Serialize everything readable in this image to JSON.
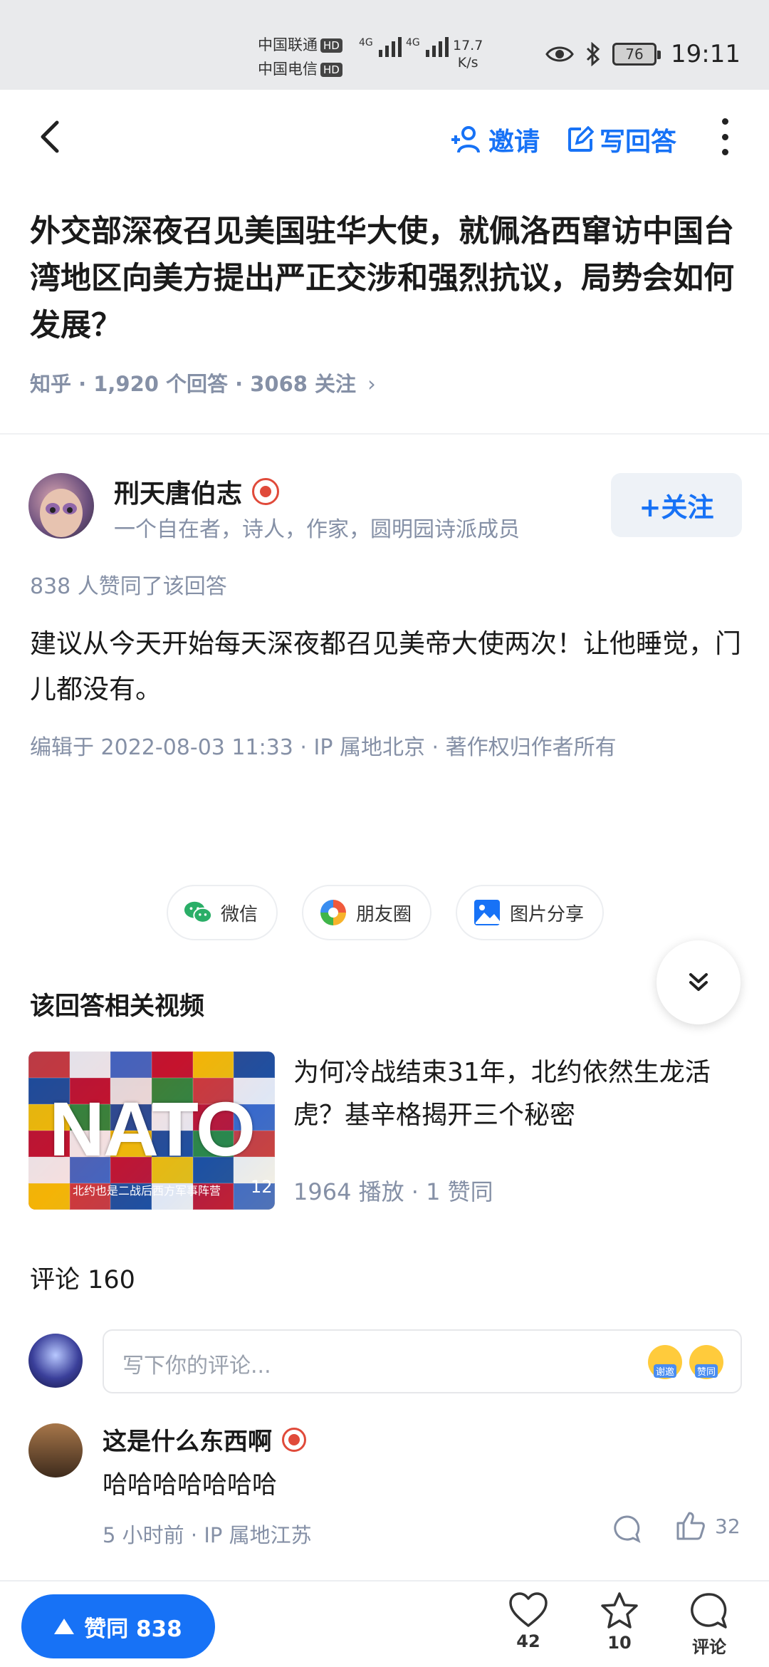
{
  "status_bar": {
    "carrier1": "中国联通",
    "carrier2": "中国电信",
    "hd": "HD",
    "net1": "4G",
    "net2": "4G",
    "speed_value": "17.7",
    "speed_unit": "K/s",
    "battery": "76",
    "time": "19:11"
  },
  "nav": {
    "invite_label": "邀请",
    "write_answer_label": "写回答"
  },
  "question": {
    "title": "外交部深夜召见美国驻华大使，就佩洛西窜访中国台湾地区向美方提出严正交涉和强烈抗议，局势会如何发展？",
    "meta": "知乎 · 1,920 个回答 · 3068 关注"
  },
  "answer": {
    "author_name": "刑天唐伯志",
    "author_bio": "一个自在者，诗人，作家，圆明园诗派成员",
    "follow_label": "+关注",
    "upvote_info": "838 人赞同了该回答",
    "body": "建议从今天开始每天深夜都召见美帝大使两次！让他睡觉，门儿都没有。",
    "meta": "编辑于 2022-08-03 11:33 · IP 属地北京 · 著作权归作者所有"
  },
  "share": {
    "wechat": "微信",
    "moments": "朋友圈",
    "image_share": "图片分享"
  },
  "related": {
    "title": "该回答相关视频",
    "video": {
      "thumb_word": "NATO",
      "thumb_caption": "北约也是二战后西方军事阵营",
      "duration": "12",
      "title": "为何冷战结束31年，北约依然生龙活虎？基辛格揭开三个秘密",
      "meta": "1964 播放 · 1 赞同"
    }
  },
  "comments": {
    "title": "评论 160",
    "placeholder": "写下你的评论...",
    "emoji1": "谢邀",
    "emoji2": "赞同",
    "items": [
      {
        "name": "这是什么东西啊",
        "text": "哈哈哈哈哈哈哈",
        "meta": "5 小时前 · IP 属地江苏",
        "likes": "32"
      }
    ]
  },
  "bottom_bar": {
    "vote_label": "赞同 838",
    "likes": "42",
    "favorites": "10",
    "comment_label": "评论"
  },
  "colors": {
    "accent": "#1772f6",
    "meta_gray": "#8590a6",
    "status_bg": "#e9eaec"
  }
}
